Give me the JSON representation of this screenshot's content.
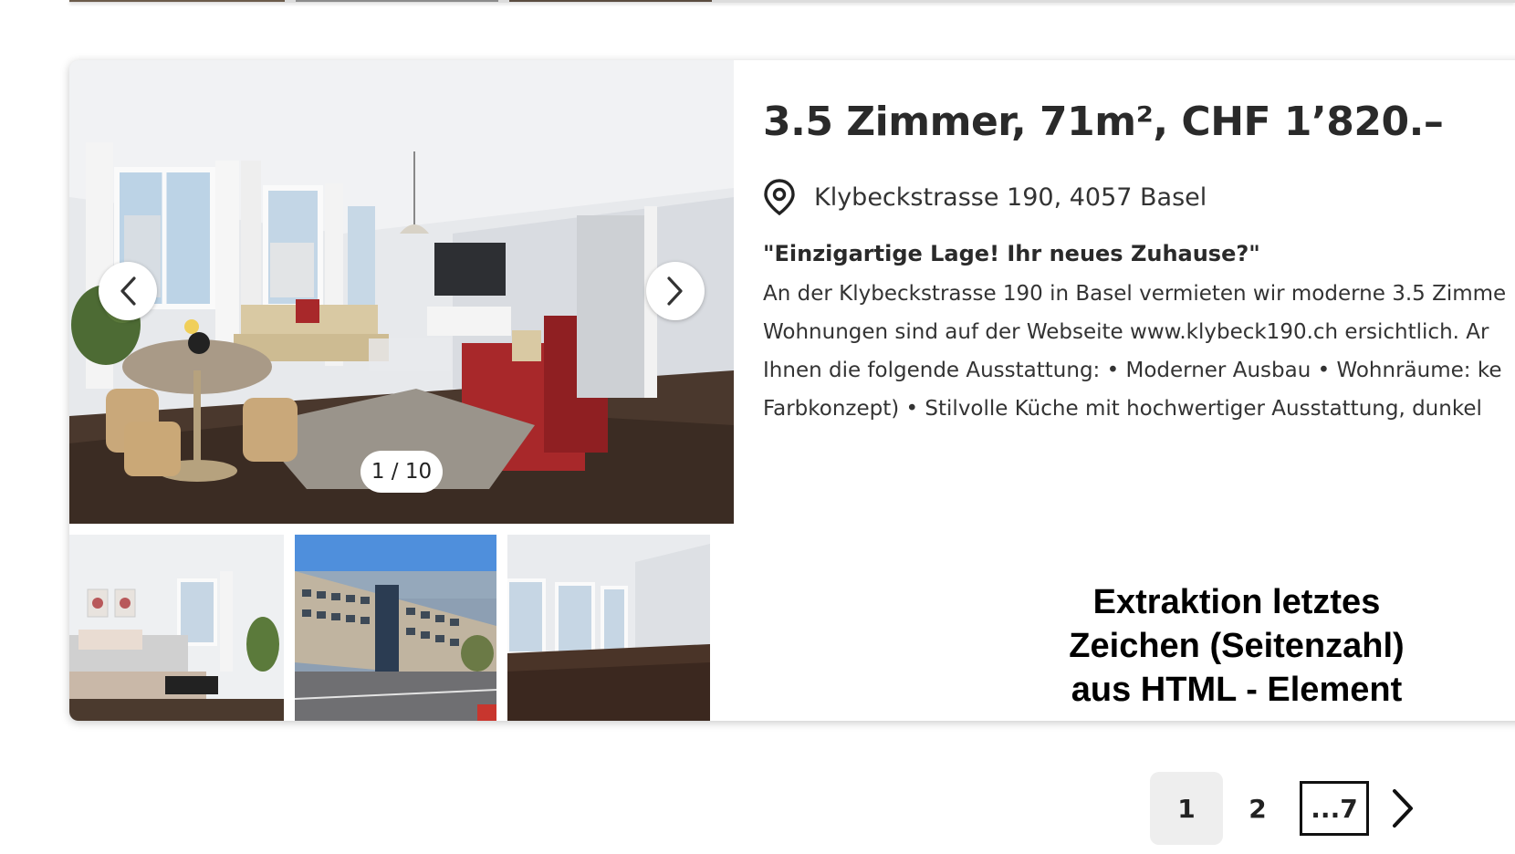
{
  "listing": {
    "title": "3.5 Zimmer, 71m², CHF 1’820.–",
    "address": "Klybeckstrasse 190, 4057 Basel",
    "headline": "\"Einzigartige Lage! Ihr neues Zuhause?\"",
    "description_lines": [
      "An der Klybeckstrasse 190 in Basel vermieten wir moderne 3.5 Zimme",
      "Wohnungen sind auf der Webseite www.klybeck190.ch ersichtlich. Ar",
      "Ihnen die folgende Ausstattung: • Moderner Ausbau • Wohnräume: ke",
      "Farbkonzept) • Stilvolle Küche mit hochwertiger Ausstattung, dunkel"
    ],
    "gallery": {
      "counter": "1 / 10",
      "prev_icon": "chevron-left-icon",
      "next_icon": "chevron-right-icon",
      "thumbnails": [
        "bedroom-photo",
        "building-exterior-photo",
        "empty-living-room-photo"
      ]
    }
  },
  "overlay_note": {
    "lines": [
      "Extraktion letztes",
      "Zeichen (Seitenzahl)",
      "aus HTML - Element"
    ]
  },
  "pagination": {
    "current": "1",
    "page2": "2",
    "last": "...7",
    "next_icon": "chevron-right-icon"
  },
  "colors": {
    "sofa_red": "#a8282a",
    "pin_icon": "#222222",
    "page_current_bg": "#eeeeee"
  }
}
